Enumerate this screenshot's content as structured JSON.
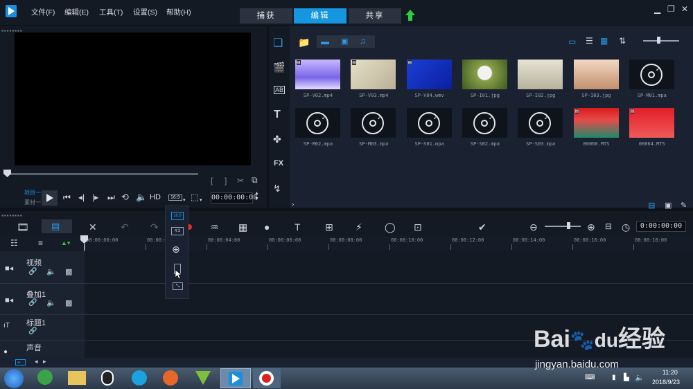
{
  "menu": {
    "file": "文件(F)",
    "edit": "编辑(E)",
    "tools": "工具(T)",
    "settings": "设置(S)",
    "help": "帮助(H)"
  },
  "tabs": {
    "capture": "捕获",
    "edit": "编辑",
    "share": "共享"
  },
  "colors": {
    "accent": "#1596e1",
    "upload": "#2ecc40"
  },
  "preview": {
    "project_label": "项目一",
    "clip_label": "素材一",
    "hd_label": "HD",
    "aspect_label": "16:9",
    "timecode": "00:00:00:00"
  },
  "library": {
    "items": [
      {
        "name": "SP-V02.mp4",
        "kind": "video",
        "icon": "video-thumbnail"
      },
      {
        "name": "SP-V03.mp4",
        "kind": "video",
        "icon": "video-thumbnail"
      },
      {
        "name": "SP-V04.wmv",
        "kind": "video",
        "icon": "video-thumbnail"
      },
      {
        "name": "SP-I01.jpg",
        "kind": "image",
        "icon": "dandelion-image"
      },
      {
        "name": "SP-I02.jpg",
        "kind": "image",
        "icon": "landscape-image"
      },
      {
        "name": "SP-I03.jpg",
        "kind": "image",
        "icon": "desert-tree-image"
      },
      {
        "name": "SP-M01.mpa",
        "kind": "audio",
        "icon": "music-disc-icon"
      },
      {
        "name": "SP-M02.mpa",
        "kind": "audio",
        "icon": "music-disc-icon"
      },
      {
        "name": "SP-M03.mpa",
        "kind": "audio",
        "icon": "music-disc-icon"
      },
      {
        "name": "SP-S01.mpa",
        "kind": "audio",
        "icon": "music-disc-icon"
      },
      {
        "name": "SP-S02.mpa",
        "kind": "audio",
        "icon": "music-disc-icon"
      },
      {
        "name": "SP-S03.mpa",
        "kind": "audio",
        "icon": "music-disc-icon"
      },
      {
        "name": "00060.MTS",
        "kind": "video",
        "icon": "video-thumbnail"
      },
      {
        "name": "00064.MTS",
        "kind": "video",
        "icon": "video-thumbnail"
      }
    ]
  },
  "timeline": {
    "timecode": "0:00:00:00",
    "ruler": [
      "00:00:00:00",
      "00:00:02",
      "00:00:04:00",
      "00:00:06:00",
      "00:00:08:00",
      "00:00:10:00",
      "00:00:12:00",
      "00:00:14:00",
      "00:00:16:00",
      "00:00:18:00"
    ],
    "tracks": [
      "视频",
      "叠加1",
      "标题1",
      "声音"
    ]
  },
  "popup": {
    "ratio_16_9": "16:9",
    "ratio_4_3": "4:3"
  },
  "taskbar": {
    "time": "11:20",
    "date": "2018/9/23"
  },
  "watermark": {
    "site": "jingyan.baidu.com",
    "brand": "Bai",
    "brand2": "经验"
  }
}
